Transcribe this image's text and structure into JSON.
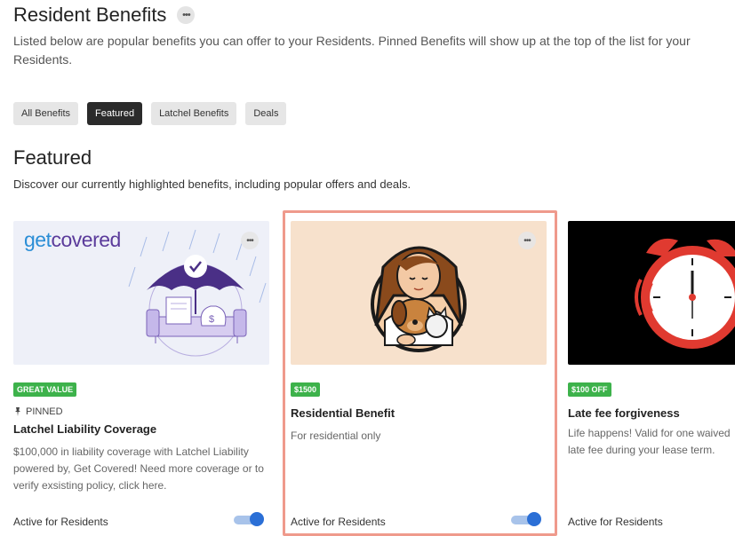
{
  "header": {
    "title": "Resident Benefits",
    "description": "Listed below are popular benefits you can offer to your Residents. Pinned Benefits will show up at the top of the list for your Residents."
  },
  "tabs": [
    {
      "label": "All Benefits",
      "active": false
    },
    {
      "label": "Featured",
      "active": true
    },
    {
      "label": "Latchel Benefits",
      "active": false
    },
    {
      "label": "Deals",
      "active": false
    }
  ],
  "section": {
    "title": "Featured",
    "description": "Discover our currently highlighted benefits, including popular offers and deals."
  },
  "cards": [
    {
      "logo_part1": "get",
      "logo_part2": "covered",
      "badge": "GREAT VALUE",
      "pinned_label": "PINNED",
      "title": "Latchel Liability Coverage",
      "description": "$100,000 in liability coverage with Latchel Liability powered by, Get Covered! Need more coverage or to verify exsisting policy, click here.",
      "active_label": "Active for Residents",
      "active": true
    },
    {
      "badge": "$1500",
      "title": "Residential Benefit",
      "description": "For residential only",
      "active_label": "Active for Residents",
      "active": true,
      "selected": true
    },
    {
      "badge": "$100 OFF",
      "title": "Late fee forgiveness",
      "description": "Life happens! Valid for one waived late fee during your lease term.",
      "active_label": "Active for Residents",
      "active": true
    }
  ],
  "colors": {
    "badge_green": "#3db24b",
    "toggle_blue": "#2b6fd6",
    "selection_border": "#ef9a8c",
    "logo_purple": "#5b3b9b",
    "logo_blue": "#2b8ed6"
  },
  "icons": {
    "more": "more-horizontal-icon",
    "pin": "pin-icon"
  }
}
